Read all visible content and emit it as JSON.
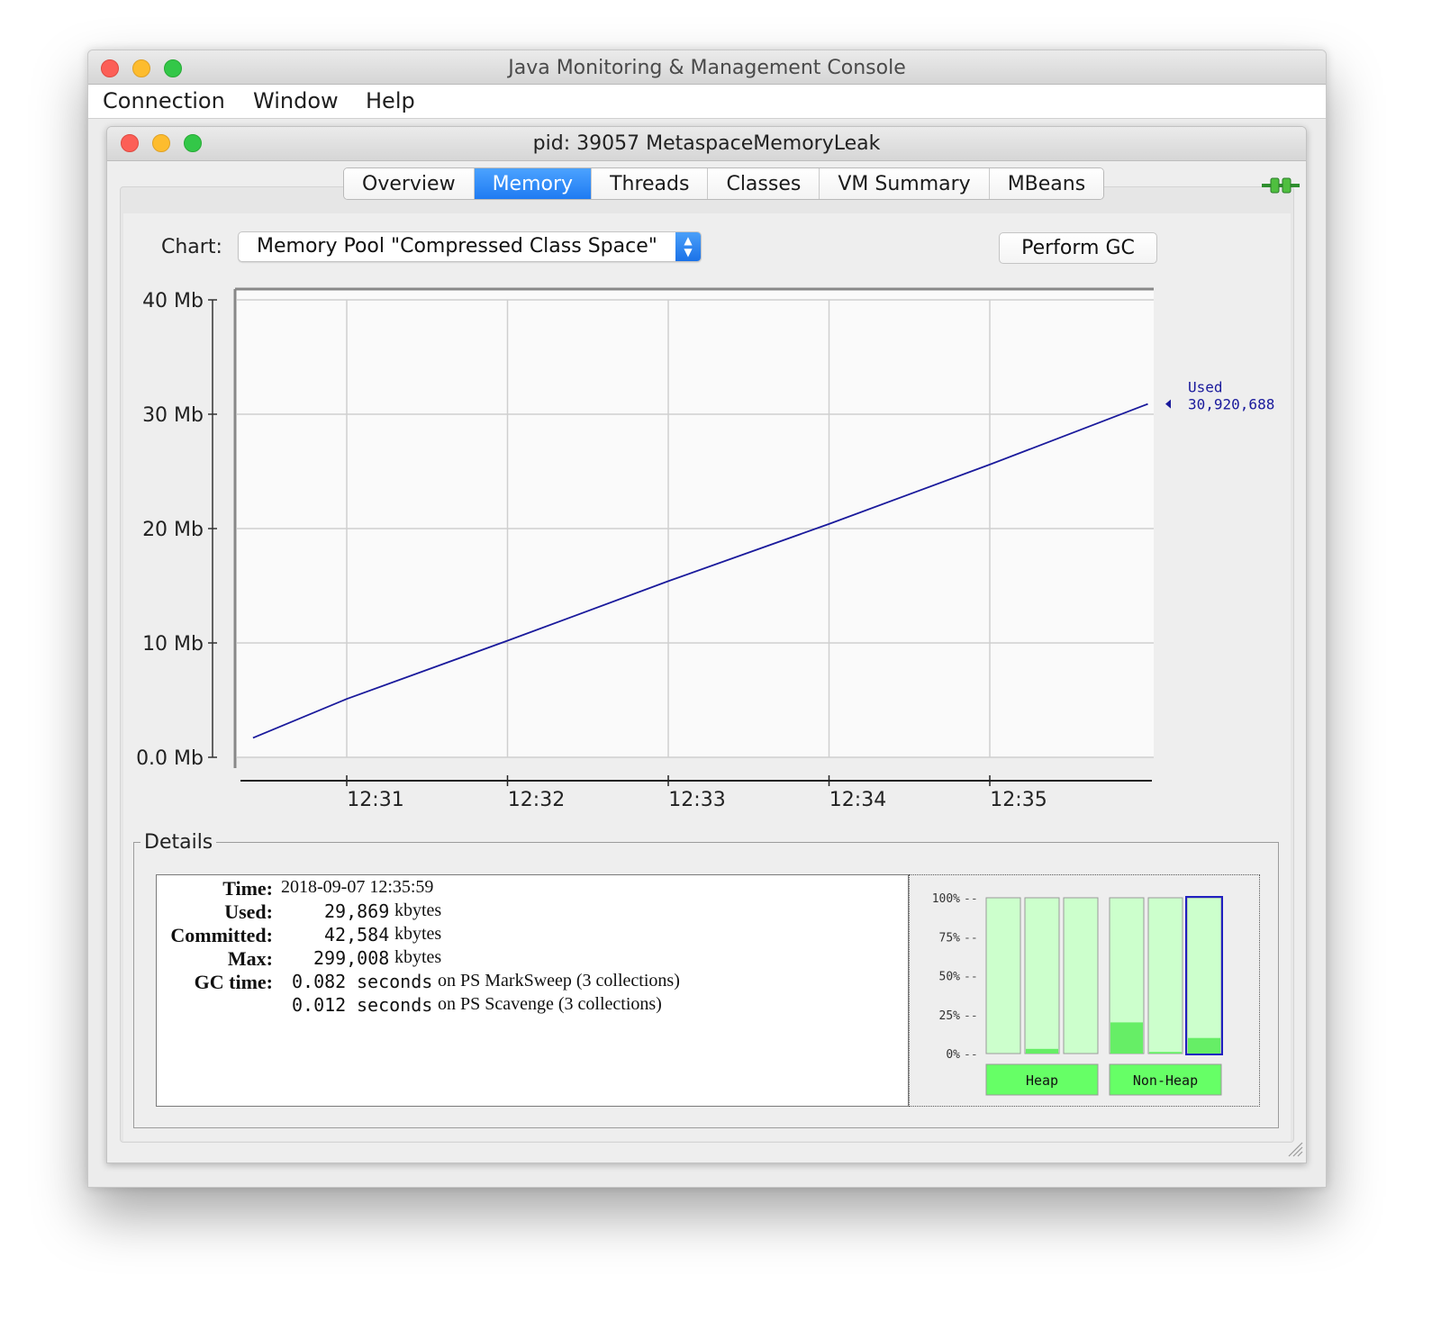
{
  "app": {
    "window_title": "Java Monitoring & Management Console",
    "menu": [
      "Connection",
      "Window",
      "Help"
    ]
  },
  "inner": {
    "title": "pid: 39057 MetaspaceMemoryLeak",
    "tabs": [
      "Overview",
      "Memory",
      "Threads",
      "Classes",
      "VM Summary",
      "MBeans"
    ],
    "active_tab": "Memory"
  },
  "controls": {
    "chart_label": "Chart:",
    "chart_select_value": "Memory Pool \"Compressed Class Space\"",
    "perform_gc_label": "Perform GC"
  },
  "chart_data": {
    "type": "line",
    "y_ticks": [
      "0.0 Mb",
      "10 Mb",
      "20 Mb",
      "30 Mb",
      "40 Mb"
    ],
    "x_ticks": [
      "12:31",
      "12:32",
      "12:33",
      "12:34",
      "12:35"
    ],
    "ylim": [
      0,
      40
    ],
    "series": [
      {
        "name": "Used",
        "color": "#1a1a9c",
        "x": [
          "12:30:25",
          "12:31",
          "12:32",
          "12:33",
          "12:34",
          "12:35",
          "12:35:59"
        ],
        "y": [
          1.7,
          5.1,
          10.2,
          15.4,
          20.4,
          25.6,
          30.9
        ]
      }
    ],
    "annotation": {
      "label": "Used",
      "value": "30,920,688"
    },
    "grid": true
  },
  "details": {
    "legend": "Details",
    "rows": [
      {
        "label": "Time:",
        "value": "2018-09-07 12:35:59"
      },
      {
        "label": "Used:",
        "number": "29,869",
        "unit": "kbytes"
      },
      {
        "label": "Committed:",
        "number": "42,584",
        "unit": "kbytes"
      },
      {
        "label": "Max:",
        "number": "299,008",
        "unit": "kbytes"
      },
      {
        "label": "GC time:",
        "number": "0.082",
        "unit": "seconds",
        "suffix": "on PS MarkSweep (3 collections)"
      },
      {
        "label": "",
        "number": "0.012",
        "unit": "seconds",
        "suffix": "on PS Scavenge (3 collections)"
      }
    ]
  },
  "pool_bars": {
    "y_ticks": [
      "100%",
      "75%",
      "50%",
      "25%",
      "0%"
    ],
    "groups": [
      {
        "label": "Heap",
        "fills": [
          0,
          0.03,
          0
        ]
      },
      {
        "label": "Non-Heap",
        "fills": [
          0.2,
          0.01,
          0.1
        ],
        "selected_index": 2
      }
    ],
    "colors": {
      "bar_bg": "#ccffcc",
      "bar_fill": "#66ee66",
      "label_bg": "#66ff66"
    }
  }
}
